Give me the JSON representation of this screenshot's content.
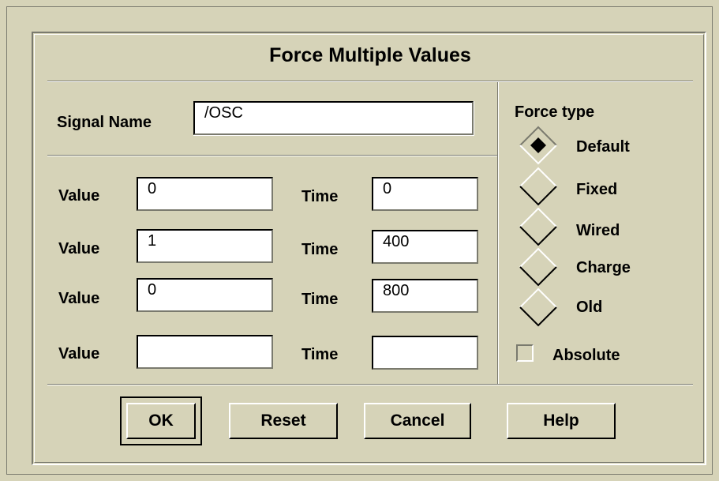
{
  "dialog": {
    "title": "Force Multiple Values",
    "signal_label": "Signal Name",
    "signal_value": "/OSC",
    "rows": [
      {
        "value_label": "Value",
        "value": "0",
        "time_label": "Time",
        "time": "0"
      },
      {
        "value_label": "Value",
        "value": "1",
        "time_label": "Time",
        "time": "400"
      },
      {
        "value_label": "Value",
        "value": "0",
        "time_label": "Time",
        "time": "800"
      },
      {
        "value_label": "Value",
        "value": "",
        "time_label": "Time",
        "time": ""
      }
    ],
    "force_type": {
      "label": "Force type",
      "options": [
        "Default",
        "Fixed",
        "Wired",
        "Charge",
        "Old"
      ],
      "selected": "Default"
    },
    "absolute": {
      "label": "Absolute",
      "checked": false
    },
    "buttons": {
      "ok": "OK",
      "reset": "Reset",
      "cancel": "Cancel",
      "help": "Help"
    },
    "colors": {
      "background": "#d6d3b8",
      "shadow": "#7a7a6e",
      "highlight": "#ffffff"
    }
  }
}
